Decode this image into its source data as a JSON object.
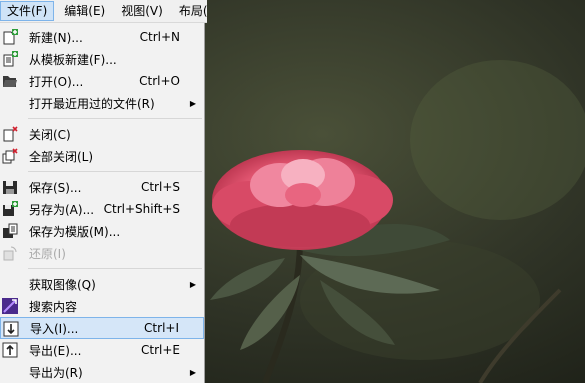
{
  "menubar": [
    {
      "label": "文件(F)",
      "active": true
    },
    {
      "label": "编辑(E)",
      "active": false
    },
    {
      "label": "视图(V)",
      "active": false
    },
    {
      "label": "布局(",
      "active": false
    }
  ],
  "menu": {
    "items": [
      {
        "label": "新建(N)...",
        "shortcut": "Ctrl+N",
        "icon": "new-document-icon"
      },
      {
        "label": "从模板新建(F)...",
        "shortcut": "",
        "icon": "new-from-template-icon"
      },
      {
        "label": "打开(O)...",
        "shortcut": "Ctrl+O",
        "icon": "open-folder-icon"
      },
      {
        "label": "打开最近用过的文件(R)",
        "shortcut": "",
        "icon": "",
        "submenu": true
      },
      {
        "label": "关闭(C)",
        "shortcut": "",
        "icon": "close-document-icon"
      },
      {
        "label": "全部关闭(L)",
        "shortcut": "",
        "icon": "close-all-icon"
      },
      {
        "label": "保存(S)...",
        "shortcut": "Ctrl+S",
        "icon": "save-icon"
      },
      {
        "label": "另存为(A)...",
        "shortcut": "Ctrl+Shift+S",
        "icon": "save-as-icon"
      },
      {
        "label": "保存为模版(M)...",
        "shortcut": "",
        "icon": "save-as-template-icon"
      },
      {
        "label": "还原(I)",
        "shortcut": "",
        "icon": "revert-icon",
        "disabled": true
      },
      {
        "label": "获取图像(Q)",
        "shortcut": "",
        "icon": "",
        "submenu": true
      },
      {
        "label": "搜索内容",
        "shortcut": "",
        "icon": "search-content-icon"
      },
      {
        "label": "导入(I)...",
        "shortcut": "Ctrl+I",
        "icon": "import-icon",
        "selected": true
      },
      {
        "label": "导出(E)...",
        "shortcut": "Ctrl+E",
        "icon": "export-icon"
      },
      {
        "label": "导出为(R)",
        "shortcut": "",
        "icon": "",
        "submenu": true
      }
    ],
    "submenu_arrow": "▶"
  }
}
